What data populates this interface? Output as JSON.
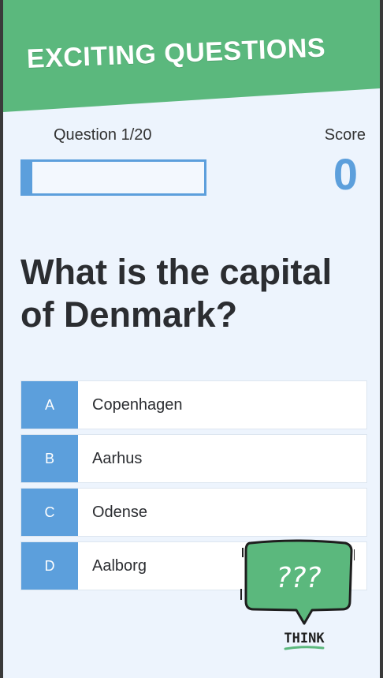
{
  "header": {
    "title": "EXCITING QUESTIONS"
  },
  "quiz": {
    "counter": "Question 1/20",
    "progress_fraction": 0.05,
    "score_label": "Score",
    "score_value": "0",
    "question": "What is the capital of Denmark?",
    "answers": [
      {
        "letter": "A",
        "text": "Copenhagen"
      },
      {
        "letter": "B",
        "text": "Aarhus"
      },
      {
        "letter": "C",
        "text": "Odense"
      },
      {
        "letter": "D",
        "text": "Aalborg"
      }
    ]
  },
  "sticker": {
    "bubble_text": "???",
    "caption": "THINK"
  },
  "colors": {
    "accent": "#5c9fdc",
    "banner": "#5bb87d",
    "background": "#edf4fd"
  }
}
